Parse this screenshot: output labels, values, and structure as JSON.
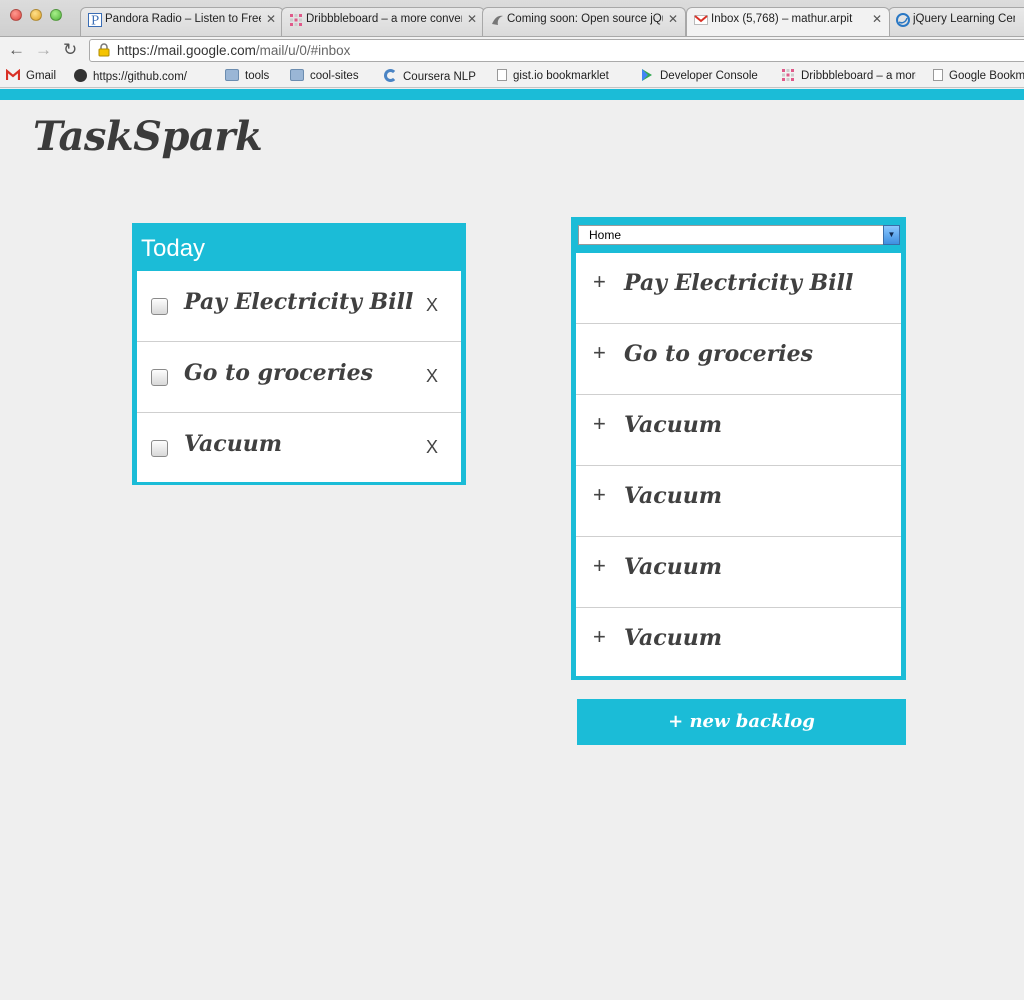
{
  "browser": {
    "tabs": [
      {
        "title": "Pandora Radio – Listen to Free Internet Radio",
        "active": false
      },
      {
        "title": "Dribbbleboard – a more convenient Dribbble",
        "active": false
      },
      {
        "title": "Coming soon: Open source jQuery",
        "active": false
      },
      {
        "title": "Inbox (5,768) – mathur.arpit",
        "active": true
      },
      {
        "title": "jQuery Learning Center",
        "active": false
      }
    ],
    "url_host": "https://mail.google.com",
    "url_path": "/mail/u/0/#inbox",
    "bookmarks": [
      {
        "label": "Gmail",
        "icon": "gmail-icon"
      },
      {
        "label": "https://github.com/",
        "icon": "github-icon"
      },
      {
        "label": "tools",
        "icon": "folder-icon"
      },
      {
        "label": "cool-sites",
        "icon": "folder-icon"
      },
      {
        "label": "Coursera NLP",
        "icon": "coursera-icon"
      },
      {
        "label": "gist.io bookmarklet",
        "icon": "page-icon"
      },
      {
        "label": "Developer Console",
        "icon": "play-store-icon"
      },
      {
        "label": "Dribbbleboard – a more convenient Dribbble",
        "icon": "dribbble-icon"
      },
      {
        "label": "Google Bookmarks",
        "icon": "page-icon"
      }
    ]
  },
  "app": {
    "logo": "TaskSpark",
    "accent": "#1bbcd7",
    "today": {
      "heading": "Today",
      "tasks": [
        {
          "title": "Pay Electricity Bill",
          "delete_label": "X"
        },
        {
          "title": "Go to groceries",
          "delete_label": "X"
        },
        {
          "title": "Vacuum",
          "delete_label": "X"
        }
      ]
    },
    "backlog": {
      "selected": "Home",
      "items": [
        {
          "plus": "+",
          "title": "Pay Electricity Bill"
        },
        {
          "plus": "+",
          "title": "Go to groceries"
        },
        {
          "plus": "+",
          "title": "Vacuum"
        },
        {
          "plus": "+",
          "title": "Vacuum"
        },
        {
          "plus": "+",
          "title": "Vacuum"
        },
        {
          "plus": "+",
          "title": "Vacuum"
        }
      ],
      "new_button": "+ new backlog"
    }
  }
}
